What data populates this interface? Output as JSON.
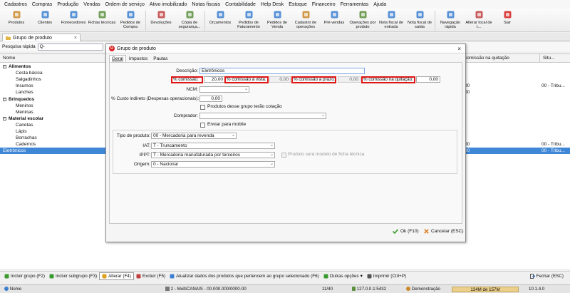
{
  "menu": [
    "Cadastros",
    "Compras",
    "Produção",
    "Vendas",
    "Ordem de serviço",
    "Ativo imobilizado",
    "Notas fiscais",
    "Contabilidade",
    "Help Desk",
    "Estoque",
    "Financeiro",
    "Ferramentas",
    "Ajuda"
  ],
  "toolbar": [
    {
      "label": "Produtos",
      "icon": "box-icon",
      "color": "#c9892d"
    },
    {
      "label": "Clientes",
      "icon": "users-icon",
      "color": "#3b7fd0"
    },
    {
      "label": "Fornecedores",
      "icon": "truck-icon",
      "color": "#3b7fd0"
    },
    {
      "label": "Fichas técnicas",
      "icon": "sheet-icon",
      "color": "#5a8f3c"
    },
    {
      "label": "Pedidos de Compra",
      "icon": "cart-icon",
      "color": "#3b7fd0"
    },
    {
      "label": "Devoluções",
      "icon": "return-icon",
      "color": "#c04040"
    },
    {
      "label": "Cópia de segurança...",
      "icon": "backup-icon",
      "color": "#5a8f3c"
    },
    {
      "label": "Orçamentos",
      "icon": "quote-icon",
      "color": "#3b7fd0"
    },
    {
      "label": "Pedidos de Faturamento",
      "icon": "invoice-icon",
      "color": "#3b7fd0"
    },
    {
      "label": "Pedidos de Venda",
      "icon": "sales-icon",
      "color": "#3b7fd0"
    },
    {
      "label": "Cadastro de operações",
      "icon": "operations-icon",
      "color": "#c9892d"
    },
    {
      "label": "Pré-vendas",
      "icon": "presale-icon",
      "color": "#3b7fd0"
    },
    {
      "label": "Operações por produto",
      "icon": "product-ops-icon",
      "color": "#5a8f3c"
    },
    {
      "label": "Nota fiscal de entrada",
      "icon": "nf-in-icon",
      "color": "#3b7fd0"
    },
    {
      "label": "Nota fiscal de saída",
      "icon": "nf-out-icon",
      "color": "#3b7fd0"
    },
    {
      "label": "Navegação rápida",
      "icon": "nav-icon",
      "color": "#3b7fd0"
    },
    {
      "label": "Alterar local de t...",
      "icon": "location-icon",
      "color": "#c04040"
    },
    {
      "label": "Sair",
      "icon": "power-icon",
      "color": "#d62020"
    }
  ],
  "tab": {
    "title": "Grupo de produto",
    "close": "×"
  },
  "search": {
    "label": "Pesquisa rápida",
    "icon": "search-icon",
    "value": "Q-"
  },
  "grid": {
    "headers": {
      "name": "Nome",
      "commission": "comissão na quitação",
      "situation": "Situ..."
    },
    "rows": [
      {
        "name": "Alimentos",
        "level": 0,
        "c1": "",
        "c2": ""
      },
      {
        "name": "Cesta básica",
        "level": 1,
        "c1": "",
        "c2": ""
      },
      {
        "name": "Salgadinhos",
        "level": 1,
        "c1": "",
        "c2": ""
      },
      {
        "name": "Insumos",
        "level": 1,
        "c1": "00",
        "c2": "00 - Tribu..."
      },
      {
        "name": "Lanches",
        "level": 1,
        "c1": "00",
        "c2": ""
      },
      {
        "name": "Brinquedos",
        "level": 0,
        "c1": "",
        "c2": ""
      },
      {
        "name": "Meninos",
        "level": 1,
        "c1": "",
        "c2": ""
      },
      {
        "name": "Meninas",
        "level": 1,
        "c1": "",
        "c2": ""
      },
      {
        "name": "Material escolar",
        "level": 0,
        "c1": "",
        "c2": ""
      },
      {
        "name": "Canetas",
        "level": 1,
        "c1": "",
        "c2": ""
      },
      {
        "name": "Lápis",
        "level": 1,
        "c1": "",
        "c2": ""
      },
      {
        "name": "Borrachas",
        "level": 1,
        "c1": "",
        "c2": ""
      },
      {
        "name": "Cadernos",
        "level": 1,
        "c1": "00",
        "c2": "00 - Tribu..."
      },
      {
        "name": "Eletrônicos",
        "level": -1,
        "c1": "00",
        "c2": "00 - Tribu..."
      }
    ]
  },
  "dialog": {
    "title": "Grupo de produto",
    "logo": "U",
    "close": "×",
    "tabs": [
      "Geral",
      "Impostos",
      "Pautas"
    ],
    "fields": {
      "descricao_label": "Descrição:",
      "descricao_value": "Eletrônicos",
      "comissao_label": "% comissão:",
      "comissao_value": "20,00",
      "comissao_vista_label": "% comissão à vista:",
      "comissao_vista_value": "0,00",
      "comissao_prazo_label": "% comissão a prazo:",
      "comissao_prazo_value": "0,00",
      "comissao_quitacao_label": "% comissão na quitação:",
      "comissao_quitacao_value": "0,00",
      "ncm_label": "NCM:",
      "custo_label": "% Custo indireto (Despesas operacionais):",
      "custo_value": "0,00",
      "cotacao_label": "Produtos desse grupo terão cotação",
      "comprador_label": "Comprador:",
      "mobile_label": "Enviar para mobile",
      "tipo_label": "Tipo de produto:",
      "tipo_value": "00 - Mercadoria para revenda",
      "iat_label": "IAT:",
      "iat_value": "T - Truncamento",
      "ippt_label": "IPPT:",
      "ippt_value": "T - Mercadoria manufaturada por terceiros",
      "modelo_label": "Produto será modelo de ficha técnica",
      "origem_label": "Origem:",
      "origem_value": "0 - Nacional"
    },
    "ok": "Ok (F10)",
    "cancel": "Cancelar (ESC)"
  },
  "bottom": [
    {
      "label": "Incluir grupo (F2)",
      "icon": "add-group-icon"
    },
    {
      "label": "Incluir subgrupo (F3)",
      "icon": "add-subgroup-icon"
    },
    {
      "label": "Alterar (F4)",
      "icon": "edit-icon"
    },
    {
      "label": "Excluir (F5)",
      "icon": "delete-icon"
    },
    {
      "label": "Atualizar dados dos produtos que pertencem ao grupo selecionado (F6)",
      "icon": "refresh-icon"
    },
    {
      "label": "Outras opções",
      "icon": "options-icon"
    },
    {
      "label": "Imprimir (Ctrl+P)",
      "icon": "print-icon"
    }
  ],
  "bottom_close": "Fechar (ESC)",
  "status": {
    "left": "Nome",
    "company": "2 - MultiCANAIS - 00.000.000/0000-00",
    "records": "11/40",
    "server": "127.0.0.1:5432",
    "mode": "Demonstração",
    "memory": "134M de 157M",
    "version": "10.1.4.0"
  }
}
